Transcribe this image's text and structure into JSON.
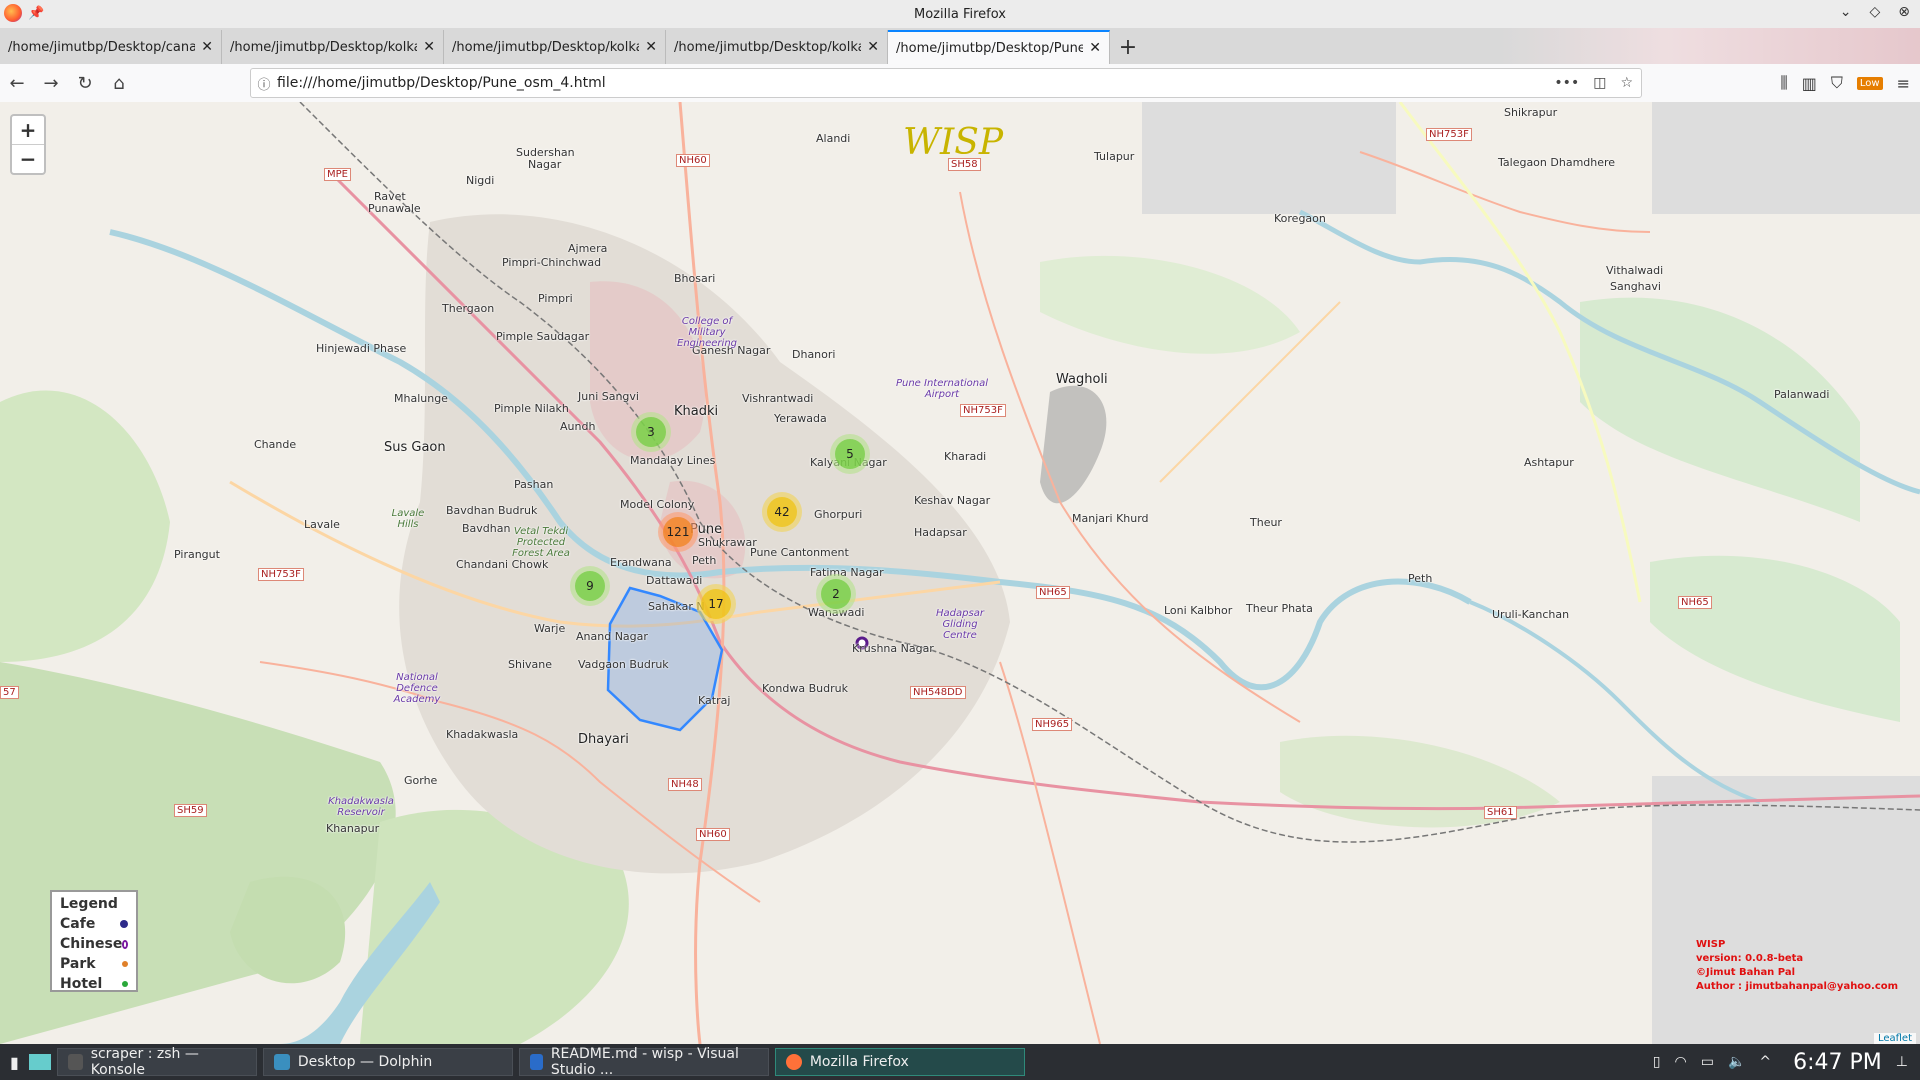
{
  "window": {
    "title": "Mozilla Firefox"
  },
  "tabs": [
    {
      "label": "/home/jimutbp/Desktop/cana"
    },
    {
      "label": "/home/jimutbp/Desktop/kolka"
    },
    {
      "label": "/home/jimutbp/Desktop/kolka"
    },
    {
      "label": "/home/jimutbp/Desktop/kolka"
    },
    {
      "label": "/home/jimutbp/Desktop/Pune"
    }
  ],
  "url": "file:///home/jimutbp/Desktop/Pune_osm_4.html",
  "toolbar": {
    "low_badge": "Low"
  },
  "map": {
    "title": "WISP",
    "zoom_in": "+",
    "zoom_out": "−",
    "places": {
      "shikrapur": "Shikrapur",
      "talegaon": "Talegaon Dhamdhere",
      "sudershan": "Sudershan",
      "nagar": "Nagar",
      "nigdi": "Nigdi",
      "alandi": "Alandi",
      "tulapur": "Tulapur",
      "ravet": "Ravet",
      "punawale": "Punawale",
      "ajmera": "Ajmera",
      "pimpri_chinchwad": "Pimpri-Chinchwad",
      "koregaon": "Koregaon",
      "bhosari": "Bhosari",
      "vithalwadi": "Vithalwadi",
      "sanghavi": "Sanghavi",
      "pimpri": "Pimpri",
      "thergaon": "Thergaon",
      "pimple_saudagar": "Pimple Saudagar",
      "ganesh_nagar": "Ganesh Nagar",
      "hinjewadi": "Hinjewadi Phase",
      "dhanori": "Dhanori",
      "wagholi": "Wagholi",
      "airport": "Pune International Airport",
      "mhalunge": "Mhalunge",
      "juni_sangvi": "Juni Sangvi",
      "vishrantwadi": "Vishrantwadi",
      "pimple_nilakh": "Pimple Nilakh",
      "khadki": "Khadki",
      "yerawada": "Yerawada",
      "palanwadi": "Palanwadi",
      "chande": "Chande",
      "sus_gaon": "Sus Gaon",
      "aundh": "Aundh",
      "mandalay_lines": "Mandalay Lines",
      "kalyani_nagar": "Kalyani Nagar",
      "kharadi": "Kharadi",
      "ashtapur": "Ashtapur",
      "pashan": "Pashan",
      "keshav_nagar": "Keshav Nagar",
      "model_colony": "Model Colony",
      "ghorpuri": "Ghorpuri",
      "manjari_khurd": "Manjari Khurd",
      "bavdhan_budruk": "Bavdhan Budruk",
      "lavale": "Lavale",
      "bavdhan": "Bavdhan",
      "pune": "Pune",
      "hadapsar": "Hadapsar",
      "theur": "Theur",
      "pune_cantonment": "Pune Cantonment",
      "erandwana": "Erandwana",
      "shukrawar": "Shukrawar",
      "peth": "Peth",
      "pirangut": "Pirangut",
      "chandani_chowk": "Chandani Chowk",
      "fatima_nagar": "Fatima Nagar",
      "dattawadi": "Dattawadi",
      "peth2": "Peth",
      "sahakar_nagar": "Sahakar N",
      "wanawadi": "Wanawadi",
      "loni_kalbhor": "Loni Kalbhor",
      "theur_phata": "Theur Phata",
      "uruli_kanchan": "Uruli-Kanchan",
      "warje": "Warje",
      "anand_nagar": "Anand Nagar",
      "shivane": "Shivane",
      "krushna_nagar": "Krushna Nagar",
      "vadgaon": "Vadgaon Budruk",
      "kondwa": "Kondwa Budruk",
      "katraj": "Katraj",
      "khadakwasla": "Khadakwasla",
      "dhayari": "Dhayari",
      "gorhe": "Gorhe",
      "khanapur": "Khanapur",
      "college": "College of Military Engineering",
      "vetal": "Vetal Tekdi Protected Forest Area",
      "lavale_hills": "Lavale Hills",
      "nda": "National Defence Academy",
      "hadapsar_gliding": "Hadapsar Gliding Centre",
      "reservoir": "Khadakwasla Reservoir"
    },
    "highways": {
      "mpe": "MPE",
      "nh60a": "NH60",
      "sh58": "SH58",
      "nh753f_a": "NH753F",
      "nh753f_b": "NH753F",
      "nh753f_c": "NH753F",
      "nh65_a": "NH65",
      "nh65_b": "NH65",
      "nh548dd": "NH548DD",
      "nh965": "NH965",
      "nh48": "NH48",
      "nh60b": "NH60",
      "sh59": "SH59",
      "sh61": "SH61",
      "nh57": "57"
    },
    "clusters": [
      {
        "count": "3",
        "color": "green"
      },
      {
        "count": "5",
        "color": "green"
      },
      {
        "count": "42",
        "color": "yellow"
      },
      {
        "count": "121",
        "color": "orange"
      },
      {
        "count": "9",
        "color": "green"
      },
      {
        "count": "2",
        "color": "green"
      },
      {
        "count": "17",
        "color": "yellow"
      }
    ],
    "legend": {
      "title": "Legend",
      "items": [
        {
          "label": "Cafe",
          "color": "#2d2a8a"
        },
        {
          "label": "Chinese",
          "color": "#7a1aa0"
        },
        {
          "label": "Park",
          "color": "#e0802a"
        },
        {
          "label": "Hotel",
          "color": "#2aa83a"
        }
      ]
    },
    "info": {
      "line1": "WISP",
      "line2": "version: 0.0.8-beta",
      "line3": "©Jimut Bahan Pal",
      "line4": "Author : jimutbahanpal@yahoo.com"
    },
    "attribution": "Leaflet"
  },
  "taskbar": {
    "items": [
      {
        "label": "scraper : zsh — Konsole"
      },
      {
        "label": "Desktop — Dolphin"
      },
      {
        "label": "README.md - wisp - Visual Studio ..."
      },
      {
        "label": "Mozilla Firefox"
      }
    ],
    "clock": "6:47 PM"
  }
}
